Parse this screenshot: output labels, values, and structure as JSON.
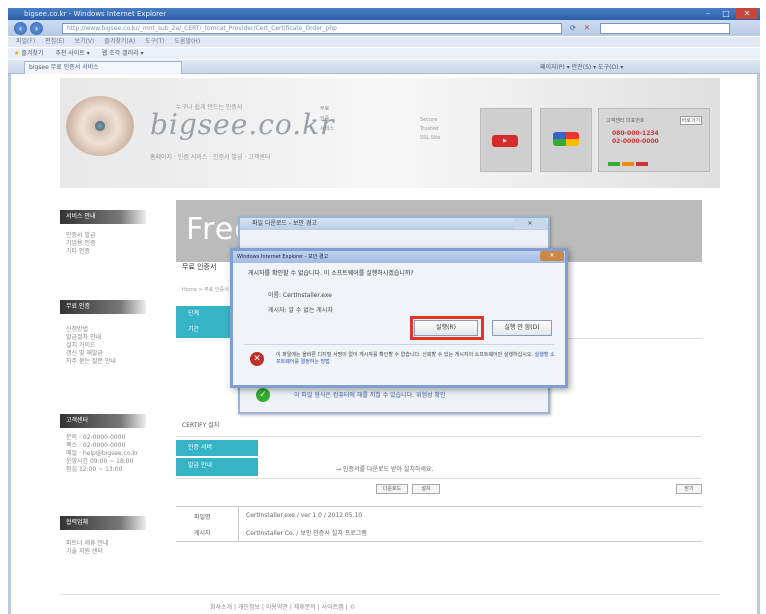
{
  "browser": {
    "window_title": "bigsee.co.kr - Windows Internet Explorer",
    "address": "http://www.bigsee.co.kr/_mnt_sub_2a/_CERT/_tomcat_Provider/Cert_Certificate_Order_php",
    "menu": [
      "파일(F)",
      "편집(E)",
      "보기(V)",
      "즐겨찾기(A)",
      "도구(T)",
      "도움말(H)"
    ],
    "favorites_label": "즐겨찾기",
    "favorites_items": [
      "추천 사이트 ▾",
      "웹 조각 갤러리 ▾"
    ],
    "tab_label": "bigsee 무료 인증서 서비스",
    "command_bar": "페이지(P) ▾  안전(S) ▾  도구(O) ▾"
  },
  "site": {
    "slogan": "누구나 쉽게 만드는 인증서",
    "logo": "bigsee.co.kr",
    "logo_sub": "홈페이지 · 인증 서비스 · 인증서 발급 · 고객센터",
    "links": [
      "무료",
      "인증",
      "서비스"
    ],
    "mid_text": [
      "Secure",
      "Trusted",
      "SSL Site"
    ],
    "phone_label": "고객센터 대표번호",
    "mini_btn": "바로가기",
    "phone_lines": [
      "080-000-1234",
      "02-0000-0000"
    ]
  },
  "sidebar": {
    "sections": [
      {
        "title": "서비스 안내",
        "items": [
          "인증서 발급",
          "기업용 인증",
          "기타 인증"
        ]
      },
      {
        "title": "무료 인증",
        "items": [
          "신청방법",
          "발급절차 안내",
          "설치 가이드",
          "갱신 및 재발급",
          "자주 묻는 질문 안내"
        ]
      },
      {
        "title": "고객센터",
        "items": [
          "문의 : 02-0000-0000",
          "팩스 : 02-0000-0000",
          "메일 : help@bigsee.co.kr",
          "운영시간 09:00 ~ 18:00",
          "점심 12:00 ~ 13:00"
        ]
      },
      {
        "title": "협력업체",
        "items": [
          "파트너 제휴 안내",
          "기술 지원 센터"
        ]
      }
    ]
  },
  "main": {
    "banner_title": "Free SSL",
    "heading": "무료 인증서",
    "crumb": "Home > 무료 인증서 > 발급",
    "rows": [
      "단계",
      "기간"
    ],
    "cert_label": "CERTIFY 설치",
    "table_rows": [
      "인증 서버",
      "발급 안내"
    ],
    "table_note": "→ 인증서를 다운로드 받아 설치하세요.",
    "buttons": [
      "다운로드",
      "설치",
      "닫기"
    ],
    "info": [
      {
        "label": "파일명",
        "value": "CertInstaller.exe / ver 1.0 / 2012.05.10"
      },
      {
        "label": "게시자",
        "value": "CertInstaller Co. / 보안 인증서 설치 프로그램"
      }
    ]
  },
  "dialog_back": {
    "title": "파일 다운로드 - 보안 경고",
    "close": "✕",
    "warn_text": "이 파일 형식은 컴퓨터에 해를 끼칠 수 있습니다. 위험성 확인"
  },
  "dialog": {
    "title": "Windows Internet Explorer - 보안 경고",
    "close": "✕",
    "question": "게시자를 확인할 수 없습니다. 이 소프트웨어를 실행하시겠습니까?",
    "name_line": "이름: CertInstaller.exe",
    "publisher_line": "게시자: 알 수 없는 게시자",
    "run_label": "실행(R)",
    "save_label": "실행 안 함(D)",
    "warn": "이 파일에는 올바른 디지털 서명이 없어 게시자를 확인할 수 없습니다. 신뢰할 수 있는 게시자의 소프트웨어만 실행하십시오.",
    "warn_link": "실행할 소프트웨어를 결정하는 방법"
  },
  "footer": "회사소개 | 개인정보 | 이용약관 | 제휴문의 | 사이트맵 | ©",
  "colors": {
    "teal": "#36b4c6",
    "highlight": "#e2332f",
    "ie_blue": "#2a5ea8"
  }
}
